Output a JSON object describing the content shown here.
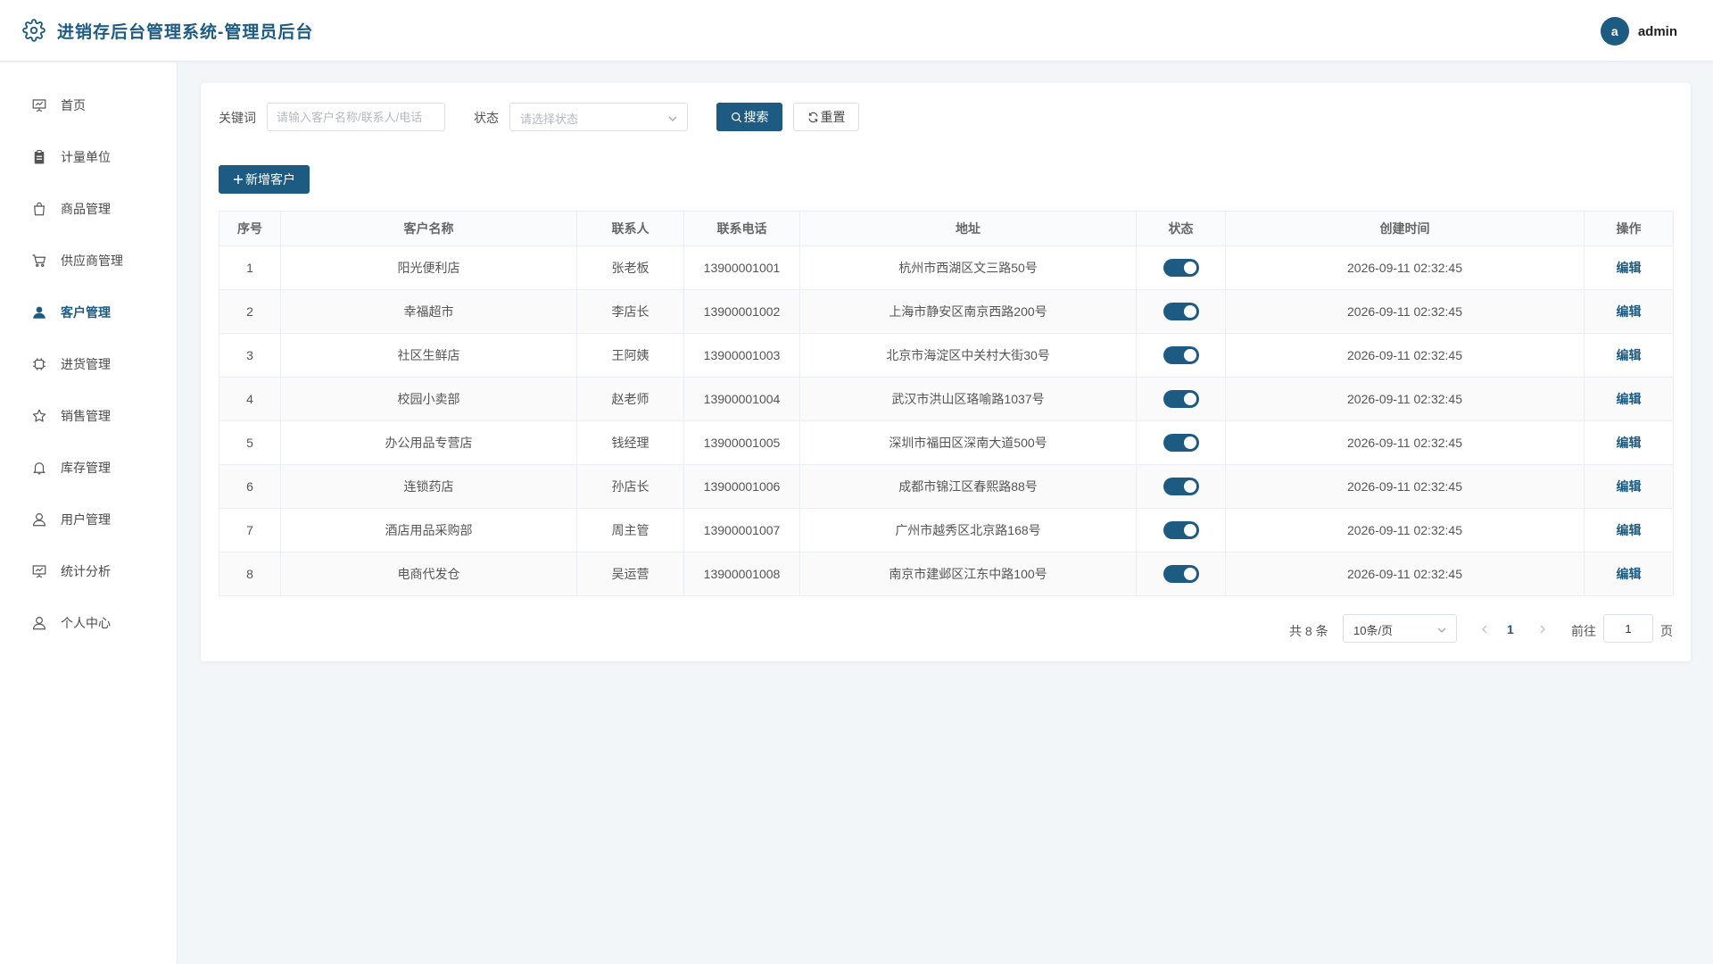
{
  "app": {
    "title": "进销存后台管理系统-管理员后台"
  },
  "user": {
    "avatar_letter": "a",
    "name": "admin"
  },
  "sidebar": {
    "items": [
      {
        "label": "首页",
        "icon": "presentation-icon"
      },
      {
        "label": "计量单位",
        "icon": "clipboard-icon"
      },
      {
        "label": "商品管理",
        "icon": "shopping-bag-icon"
      },
      {
        "label": "供应商管理",
        "icon": "cart-icon"
      },
      {
        "label": "客户管理",
        "icon": "user-filled-icon",
        "active": true
      },
      {
        "label": "进货管理",
        "icon": "chip-icon"
      },
      {
        "label": "销售管理",
        "icon": "star-icon"
      },
      {
        "label": "库存管理",
        "icon": "bell-icon"
      },
      {
        "label": "用户管理",
        "icon": "user-icon"
      },
      {
        "label": "统计分析",
        "icon": "presentation-icon"
      },
      {
        "label": "个人中心",
        "icon": "user-icon"
      }
    ]
  },
  "filters": {
    "keyword_label": "关键词",
    "keyword_placeholder": "请输入客户名称/联系人/电话",
    "keyword_value": "",
    "status_label": "状态",
    "status_placeholder": "请选择状态",
    "search_label": "搜索",
    "reset_label": "重置"
  },
  "toolbar": {
    "add_label": "新增客户"
  },
  "table": {
    "columns": [
      "序号",
      "客户名称",
      "联系人",
      "联系电话",
      "地址",
      "状态",
      "创建时间",
      "操作"
    ],
    "edit_label": "编辑",
    "rows": [
      {
        "no": "1",
        "name": "阳光便利店",
        "contact": "张老板",
        "phone": "13900001001",
        "address": "杭州市西湖区文三路50号",
        "enabled": true,
        "created": "2026-09-11 02:32:45"
      },
      {
        "no": "2",
        "name": "幸福超市",
        "contact": "李店长",
        "phone": "13900001002",
        "address": "上海市静安区南京西路200号",
        "enabled": true,
        "created": "2026-09-11 02:32:45"
      },
      {
        "no": "3",
        "name": "社区生鲜店",
        "contact": "王阿姨",
        "phone": "13900001003",
        "address": "北京市海淀区中关村大街30号",
        "enabled": true,
        "created": "2026-09-11 02:32:45"
      },
      {
        "no": "4",
        "name": "校园小卖部",
        "contact": "赵老师",
        "phone": "13900001004",
        "address": "武汉市洪山区珞喻路1037号",
        "enabled": true,
        "created": "2026-09-11 02:32:45"
      },
      {
        "no": "5",
        "name": "办公用品专营店",
        "contact": "钱经理",
        "phone": "13900001005",
        "address": "深圳市福田区深南大道500号",
        "enabled": true,
        "created": "2026-09-11 02:32:45"
      },
      {
        "no": "6",
        "name": "连锁药店",
        "contact": "孙店长",
        "phone": "13900001006",
        "address": "成都市锦江区春熙路88号",
        "enabled": true,
        "created": "2026-09-11 02:32:45"
      },
      {
        "no": "7",
        "name": "酒店用品采购部",
        "contact": "周主管",
        "phone": "13900001007",
        "address": "广州市越秀区北京路168号",
        "enabled": true,
        "created": "2026-09-11 02:32:45"
      },
      {
        "no": "8",
        "name": "电商代发仓",
        "contact": "吴运营",
        "phone": "13900001008",
        "address": "南京市建邺区江东中路100号",
        "enabled": true,
        "created": "2026-09-11 02:32:45"
      }
    ]
  },
  "pagination": {
    "total_text": "共 8 条",
    "page_size": "10条/页",
    "current_page": "1",
    "goto_label": "前往",
    "goto_value": "1",
    "page_suffix": "页"
  },
  "colors": {
    "primary": "#1d5b82",
    "background": "#f3f6f9"
  }
}
